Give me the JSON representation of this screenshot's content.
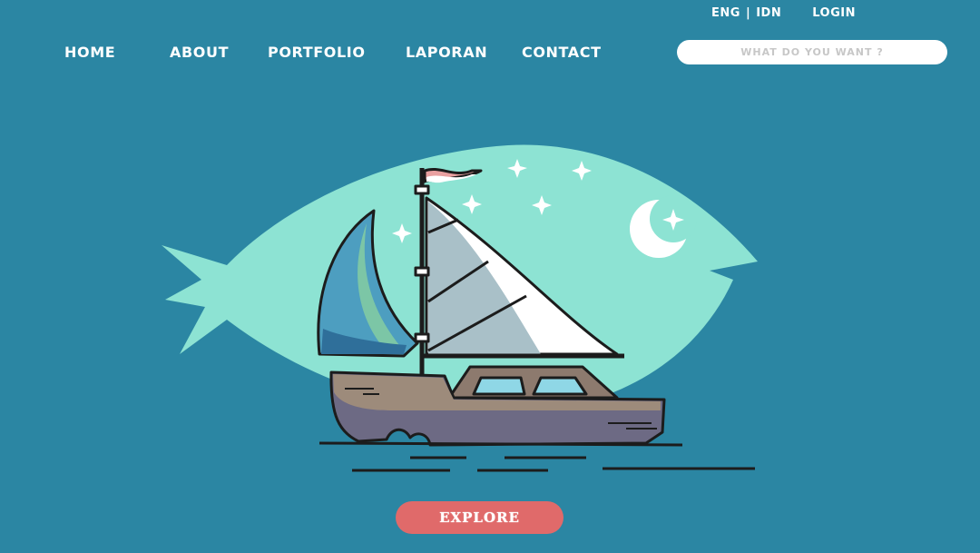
{
  "topbar": {
    "lang_eng": "ENG",
    "lang_sep": "|",
    "lang_idn": "IDN",
    "login": "LOGIN"
  },
  "nav": {
    "items": [
      "HOME",
      "ABOUT",
      "PORTFOLIO",
      "LAPORAN",
      "CONTACT"
    ]
  },
  "search": {
    "placeholder": "WHAT DO YOU WANT ?"
  },
  "hero": {
    "illustration": "fish-sailboat-illustration"
  },
  "cta": {
    "label": "EXPLORE"
  },
  "colors": {
    "background": "#2b86a3",
    "fish": "#8de3d3",
    "button": "#e06a6a",
    "text": "#ffffff"
  }
}
